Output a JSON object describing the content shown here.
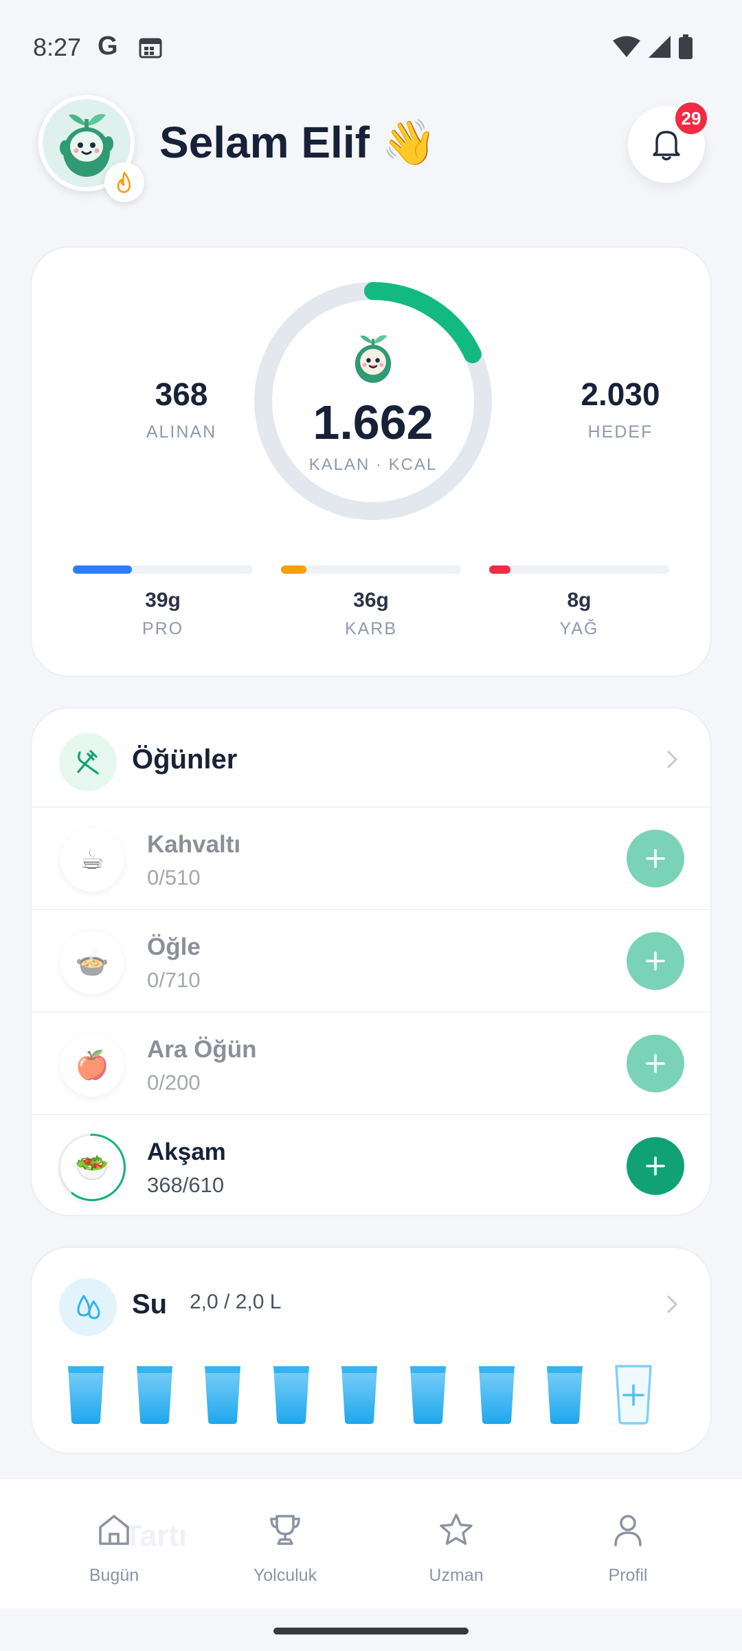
{
  "status_bar": {
    "time": "8:27",
    "g_label": "G"
  },
  "header": {
    "greeting": "Selam Elif 👋",
    "notification_count": "29"
  },
  "summary": {
    "consumed": {
      "value": "368",
      "label": "ALINAN"
    },
    "target": {
      "value": "2.030",
      "label": "HEDEF"
    },
    "remaining": {
      "value": "1.662",
      "label": "KALAN · KCAL"
    },
    "progress_fraction": 0.18,
    "macros": [
      {
        "value": "39g",
        "label": "PRO",
        "fill_fraction": 0.33,
        "color": "#2f7df6"
      },
      {
        "value": "36g",
        "label": "KARB",
        "fill_fraction": 0.14,
        "color": "#f59f0a"
      },
      {
        "value": "8g",
        "label": "YAĞ",
        "fill_fraction": 0.12,
        "color": "#f02b43"
      }
    ]
  },
  "meals": {
    "title": "Öğünler",
    "items": [
      {
        "name": "Kahvaltı",
        "calories": "0/510",
        "emoji": "☕",
        "state": "muted",
        "progress_fraction": 0
      },
      {
        "name": "Öğle",
        "calories": "0/710",
        "emoji": "🍲",
        "state": "muted",
        "progress_fraction": 0
      },
      {
        "name": "Ara Öğün",
        "calories": "0/200",
        "emoji": "🍎",
        "state": "muted",
        "progress_fraction": 0
      },
      {
        "name": "Akşam",
        "calories": "368/610",
        "emoji": "🥗",
        "state": "active",
        "progress_fraction": 0.6
      }
    ]
  },
  "water": {
    "title": "Su",
    "amount": "2,0 / 2,0 L",
    "filled_cups": 8,
    "total_cups": 9
  },
  "bottom_nav": {
    "ghost_text": "Tartı",
    "items": [
      {
        "label": "Bugün",
        "icon": "home-icon"
      },
      {
        "label": "Yolculuk",
        "icon": "trophy-icon"
      },
      {
        "label": "Uzman",
        "icon": "star-icon"
      },
      {
        "label": "Profil",
        "icon": "profile-icon"
      }
    ]
  },
  "colors": {
    "accent_green": "#10a275",
    "ring_track": "#e3e8ef",
    "ring_progress": "#12b981",
    "water_blue": "#2db2f0"
  }
}
